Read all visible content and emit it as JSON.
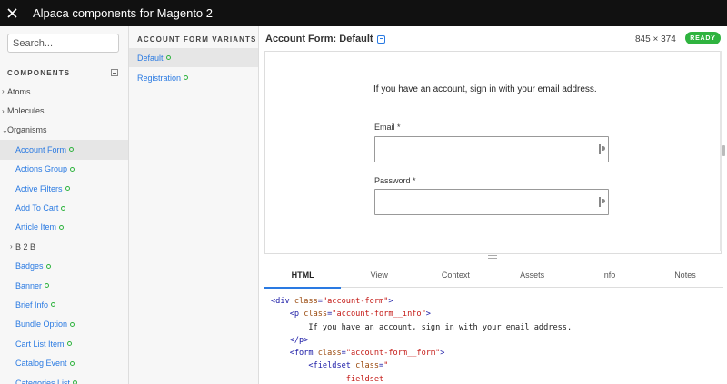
{
  "window": {
    "title": "Alpaca components for Magento 2"
  },
  "search": {
    "placeholder": "Search..."
  },
  "components": {
    "heading": "COMPONENTS",
    "tree": [
      {
        "label": "Atoms",
        "kind": "group",
        "caret": "›"
      },
      {
        "label": "Molecules",
        "kind": "group",
        "caret": "›"
      },
      {
        "label": "Organisms",
        "kind": "group",
        "caret": "⌄"
      },
      {
        "label": "Account Form",
        "kind": "leaf",
        "active": true
      },
      {
        "label": "Actions Group",
        "kind": "leaf"
      },
      {
        "label": "Active Filters",
        "kind": "leaf"
      },
      {
        "label": "Add To Cart",
        "kind": "leaf"
      },
      {
        "label": "Article Item",
        "kind": "leaf"
      },
      {
        "label": "B 2 B",
        "kind": "sub",
        "caret": "›"
      },
      {
        "label": "Badges",
        "kind": "leaf"
      },
      {
        "label": "Banner",
        "kind": "leaf"
      },
      {
        "label": "Brief Info",
        "kind": "leaf"
      },
      {
        "label": "Bundle Option",
        "kind": "leaf"
      },
      {
        "label": "Cart List Item",
        "kind": "leaf"
      },
      {
        "label": "Catalog Event",
        "kind": "leaf"
      },
      {
        "label": "Categories List",
        "kind": "leaf"
      }
    ]
  },
  "variants": {
    "heading": "ACCOUNT FORM VARIANTS",
    "items": [
      {
        "label": "Default",
        "active": true
      },
      {
        "label": "Registration",
        "active": false
      }
    ]
  },
  "main": {
    "title": "Account Form: Default",
    "size": "845 × 374",
    "status": "READY"
  },
  "preview": {
    "info": "If you have an account, sign in with your email address.",
    "email_label": "Email *",
    "password_label": "Password *"
  },
  "tabs": [
    "HTML",
    "View",
    "Context",
    "Assets",
    "Info",
    "Notes"
  ],
  "code": {
    "lines": [
      {
        "indent": "",
        "parts": [
          [
            "tag",
            "<div "
          ],
          [
            "attr",
            "class"
          ],
          [
            "tag",
            "="
          ],
          [
            "str",
            "\"account-form\""
          ],
          [
            "tag",
            ">"
          ]
        ]
      },
      {
        "indent": "    ",
        "parts": [
          [
            "tag",
            "<p "
          ],
          [
            "attr",
            "class"
          ],
          [
            "tag",
            "="
          ],
          [
            "str",
            "\"account-form__info\""
          ],
          [
            "tag",
            ">"
          ]
        ]
      },
      {
        "indent": "        ",
        "parts": [
          [
            "txt",
            "If you have an account, sign in with your email address."
          ]
        ]
      },
      {
        "indent": "    ",
        "parts": [
          [
            "tag",
            "</p>"
          ]
        ]
      },
      {
        "indent": "    ",
        "parts": [
          [
            "tag",
            "<form "
          ],
          [
            "attr",
            "class"
          ],
          [
            "tag",
            "="
          ],
          [
            "str",
            "\"account-form__form\""
          ],
          [
            "tag",
            ">"
          ]
        ]
      },
      {
        "indent": "        ",
        "parts": [
          [
            "tag",
            "<fieldset "
          ],
          [
            "attr",
            "class"
          ],
          [
            "tag",
            "="
          ],
          [
            "str",
            "\""
          ]
        ]
      },
      {
        "indent": "                ",
        "parts": [
          [
            "str",
            "fieldset"
          ]
        ]
      }
    ]
  },
  "colors": {
    "accent": "#2a7ae2",
    "ready": "#2fb33f",
    "topbar": "#111111"
  },
  "icons": {
    "close": "close-icon",
    "external": "external-link-icon",
    "password_manager": "password-key-icon"
  }
}
